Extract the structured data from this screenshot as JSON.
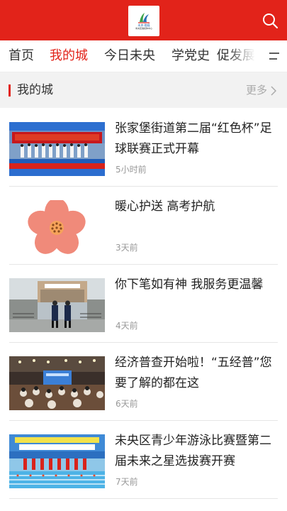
{
  "header": {
    "logo_text": "未央·融媒",
    "logo_sub": "未央区融媒体中心",
    "search_icon": "search-icon"
  },
  "tabs": [
    {
      "label": "首页",
      "active": false
    },
    {
      "label": "我的城",
      "active": true
    },
    {
      "label": "今日未央",
      "active": false
    },
    {
      "label": "学党史",
      "active": false
    },
    {
      "label": "促发展",
      "active": false
    }
  ],
  "menu_icon": "menu-lines-icon",
  "section": {
    "title": "我的城",
    "more_label": "更多"
  },
  "news": [
    {
      "title": "张家堡街道第二届“红色杯”足球联赛正式开幕",
      "time": "5小时前",
      "thumb": "football-league-ceremony"
    },
    {
      "title": "暖心护送  高考护航",
      "time": "3天前",
      "thumb": "pink-flower"
    },
    {
      "title": "你下笔如有神  我服务更温馨",
      "time": "4天前",
      "thumb": "service-staff-outdoor"
    },
    {
      "title": "经济普查开始啦！“五经普”您要了解的都在这",
      "time": "6天前",
      "thumb": "conference-hall"
    },
    {
      "title": "未央区青少年游泳比赛暨第二届未来之星选拔赛开赛",
      "time": "7天前",
      "thumb": "swimming-competition"
    }
  ],
  "colors": {
    "brand_red": "#e2231a",
    "section_bg": "#f2f2f2",
    "text_dark": "#222222",
    "text_muted": "#999999"
  }
}
